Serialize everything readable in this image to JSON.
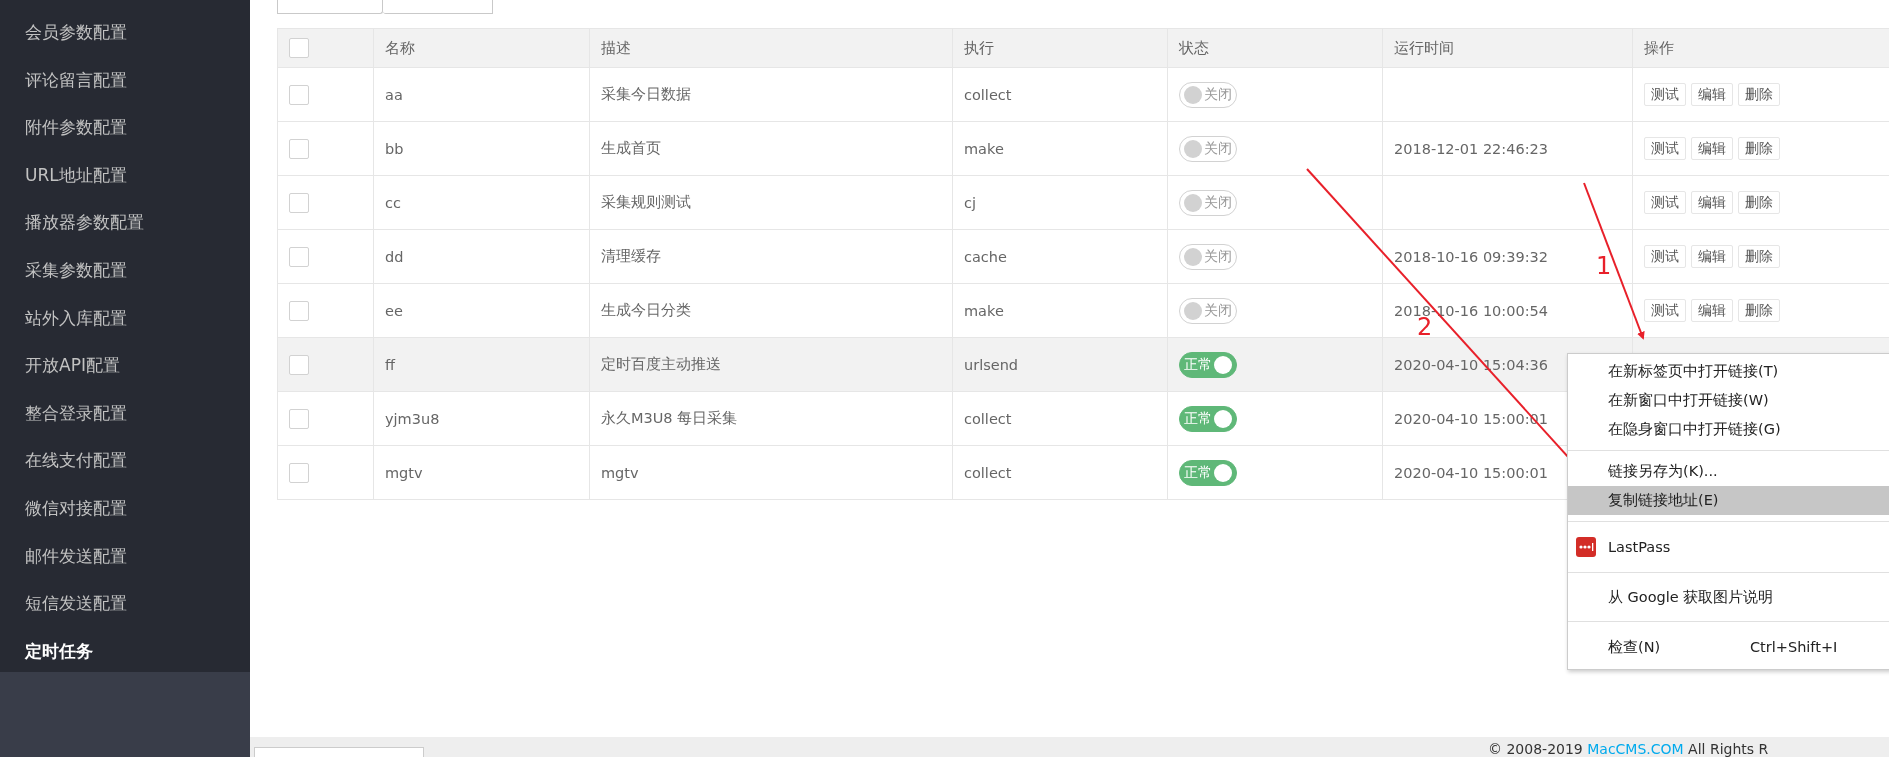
{
  "sidebar": {
    "items": [
      {
        "label": "会员参数配置",
        "selected": false
      },
      {
        "label": "评论留言配置",
        "selected": false
      },
      {
        "label": "附件参数配置",
        "selected": false
      },
      {
        "label": "URL地址配置",
        "selected": false
      },
      {
        "label": "播放器参数配置",
        "selected": false
      },
      {
        "label": "采集参数配置",
        "selected": false
      },
      {
        "label": "站外入库配置",
        "selected": false
      },
      {
        "label": "开放API配置",
        "selected": false
      },
      {
        "label": "整合登录配置",
        "selected": false
      },
      {
        "label": "在线支付配置",
        "selected": false
      },
      {
        "label": "微信对接配置",
        "selected": false
      },
      {
        "label": "邮件发送配置",
        "selected": false
      },
      {
        "label": "短信发送配置",
        "selected": false
      },
      {
        "label": "定时任务",
        "selected": true
      }
    ]
  },
  "table": {
    "header_checked": false,
    "columns": [
      "名称",
      "描述",
      "执行",
      "状态",
      "运行时间",
      "操作"
    ],
    "rows": [
      {
        "checked": false,
        "hovered": false,
        "name": "aa",
        "description": "采集今日数据",
        "exec": "collect",
        "status": {
          "label": "关闭",
          "on": false
        },
        "time": "",
        "actions": [
          "测试",
          "编辑",
          "删除"
        ]
      },
      {
        "checked": false,
        "hovered": false,
        "name": "bb",
        "description": "生成首页",
        "exec": "make",
        "status": {
          "label": "关闭",
          "on": false
        },
        "time": "2018-12-01 22:46:23",
        "actions": [
          "测试",
          "编辑",
          "删除"
        ]
      },
      {
        "checked": false,
        "hovered": false,
        "name": "cc",
        "description": "采集规则测试",
        "exec": "cj",
        "status": {
          "label": "关闭",
          "on": false
        },
        "time": "",
        "actions": [
          "测试",
          "编辑",
          "删除"
        ]
      },
      {
        "checked": false,
        "hovered": false,
        "name": "dd",
        "description": "清理缓存",
        "exec": "cache",
        "status": {
          "label": "关闭",
          "on": false
        },
        "time": "2018-10-16 09:39:32",
        "actions": [
          "测试",
          "编辑",
          "删除"
        ]
      },
      {
        "checked": false,
        "hovered": false,
        "name": "ee",
        "description": "生成今日分类",
        "exec": "make",
        "status": {
          "label": "关闭",
          "on": false
        },
        "time": "2018-10-16 10:00:54",
        "actions": [
          "测试",
          "编辑",
          "删除"
        ]
      },
      {
        "checked": false,
        "hovered": true,
        "name": "ff",
        "description": "定时百度主动推送",
        "exec": "urlsend",
        "status": {
          "label": "正常",
          "on": true
        },
        "time": "2020-04-10 15:04:36"
      },
      {
        "checked": false,
        "hovered": false,
        "name": "yjm3u8",
        "description": "永久M3U8 每日采集",
        "exec": "collect",
        "status": {
          "label": "正常",
          "on": true
        },
        "time": "2020-04-10 15:00:01"
      },
      {
        "checked": false,
        "hovered": false,
        "name": "mgtv",
        "description": "mgtv",
        "exec": "collect",
        "status": {
          "label": "正常",
          "on": true
        },
        "time": "2020-04-10 15:00:01"
      }
    ]
  },
  "context_menu": {
    "groups": [
      [
        {
          "kind": "command",
          "label": "在新标签页中打开链接(T)",
          "selected": false
        },
        {
          "kind": "command",
          "label": "在新窗口中打开链接(W)",
          "selected": false
        },
        {
          "kind": "command",
          "label": "在隐身窗口中打开链接(G)",
          "selected": false
        }
      ],
      [
        {
          "kind": "command",
          "label": "链接另存为(K)...",
          "selected": false
        },
        {
          "kind": "command",
          "label": "复制链接地址(E)",
          "selected": true
        }
      ],
      [
        {
          "kind": "extension",
          "label": "LastPass",
          "selected": false
        }
      ],
      [
        {
          "kind": "command",
          "label": "从 Google 获取图片说明",
          "selected": false
        }
      ],
      [
        {
          "kind": "command",
          "label": "检查(N)",
          "shortcut": "Ctrl+Shift+I",
          "selected": false
        }
      ]
    ]
  },
  "annotations": [
    {
      "label": "1"
    },
    {
      "label": "2"
    }
  ],
  "footer": {
    "copyright": "© 2008-2019",
    "link": "MacCMS.COM",
    "rights": "All Rights R"
  }
}
